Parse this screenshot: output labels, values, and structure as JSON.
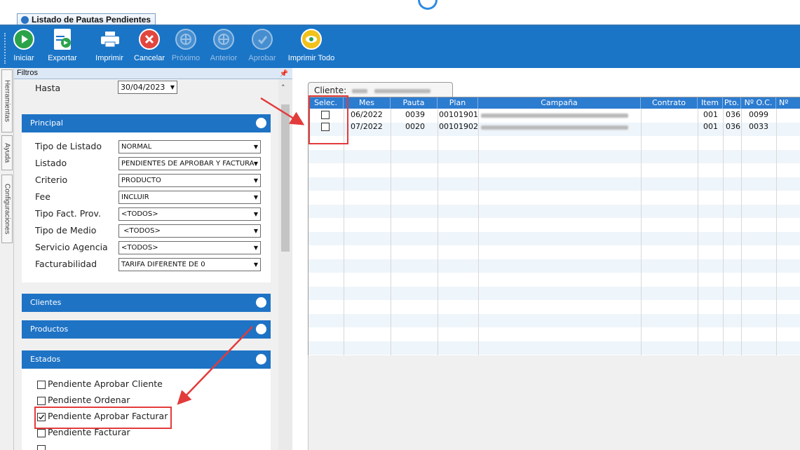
{
  "window": {
    "tab_title": "Listado de Pautas Pendientes"
  },
  "toolbar": {
    "buttons": [
      {
        "label": "Iniciar",
        "icon": "play-icon",
        "enabled": true
      },
      {
        "label": "Exportar",
        "icon": "export-icon",
        "enabled": true
      },
      {
        "label": "Imprimir",
        "icon": "printer-icon",
        "enabled": true
      },
      {
        "label": "Cancelar",
        "icon": "cancel-icon",
        "enabled": true
      },
      {
        "label": "Próximo",
        "icon": "next-icon",
        "enabled": false
      },
      {
        "label": "Anterior",
        "icon": "previous-icon",
        "enabled": false
      },
      {
        "label": "Aprobar",
        "icon": "approve-icon",
        "enabled": false
      },
      {
        "label": "Imprimir Todo",
        "icon": "print-all-icon",
        "enabled": true
      }
    ]
  },
  "side_tabs": [
    "Herramientas",
    "Ayuda",
    "Configuraciones"
  ],
  "filters": {
    "header": "Filtros",
    "hasta": {
      "label": "Hasta",
      "value": "30/04/2023"
    },
    "principal": {
      "title": "Principal",
      "fields": [
        {
          "label": "Tipo de Listado",
          "value": "NORMAL"
        },
        {
          "label": "Listado",
          "value": "PENDIENTES DE APROBAR Y FACTURA"
        },
        {
          "label": "Criterio",
          "value": "PRODUCTO"
        },
        {
          "label": "Fee",
          "value": "INCLUIR"
        },
        {
          "label": "Tipo Fact. Prov.",
          "value": "<TODOS>"
        },
        {
          "label": "Tipo de Medio",
          "value": " <TODOS>"
        },
        {
          "label": "Servicio Agencia",
          "value": "<TODOS>"
        },
        {
          "label": "Facturabilidad",
          "value": "TARIFA DIFERENTE DE 0"
        }
      ]
    },
    "clientes": {
      "title": "Clientes"
    },
    "productos": {
      "title": "Productos"
    },
    "estados": {
      "title": "Estados",
      "options": [
        {
          "label": "Pendiente Aprobar Cliente",
          "checked": false
        },
        {
          "label": "Pendiente Ordenar",
          "checked": false
        },
        {
          "label": "Pendiente Aprobar Facturar",
          "checked": true
        },
        {
          "label": "Pendiente Facturar",
          "checked": false
        }
      ]
    }
  },
  "grid": {
    "client_tab_label": "Cliente:",
    "columns": [
      "Selec.",
      "Mes",
      "Pauta",
      "Plan",
      "Campaña",
      "Contrato",
      "Item",
      "Pto.",
      "Nº O.C.",
      "Nº"
    ],
    "rows": [
      {
        "selected": false,
        "mes": "06/2022",
        "pauta": "0039",
        "plan": "00101901",
        "contrato": "",
        "item": "001",
        "pto": "036",
        "oc": "0099"
      },
      {
        "selected": false,
        "mes": "07/2022",
        "pauta": "0020",
        "plan": "00101902",
        "contrato": "",
        "item": "001",
        "pto": "036",
        "oc": "0033"
      }
    ]
  },
  "colors": {
    "toolbar": "#1a75c7",
    "section_header": "#1e73c5",
    "grid_header": "#2c7cd0",
    "annotation": "#e33b3b"
  }
}
